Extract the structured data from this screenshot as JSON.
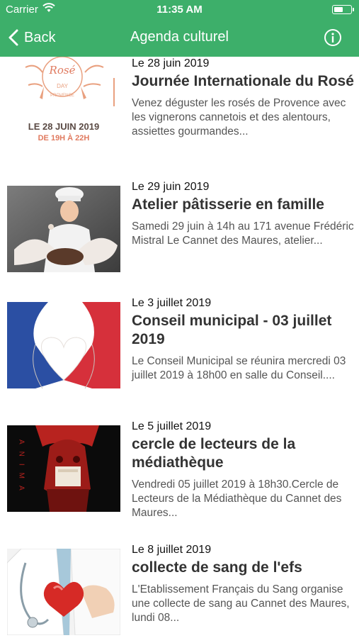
{
  "status": {
    "carrier": "Carrier",
    "time": "11:35 AM"
  },
  "nav": {
    "back_label": "Back",
    "title": "Agenda culturel"
  },
  "colors": {
    "header": "#3daf6a",
    "text": "#333333"
  },
  "events": [
    {
      "date": "Le 28 juin 2019",
      "title": "Journée Internationale du Rosé",
      "description": "Venez déguster les rosés de Provence avec les vignerons cannetois et des alentours, assiettes gourmandes...",
      "poster": {
        "line1": "Rosé",
        "line2": "DAY",
        "line3": "PROVENCE",
        "date_text": "LE 28 JUIN 2019",
        "hours_text": "DE 19H À 22H"
      }
    },
    {
      "date": "Le 29 juin 2019",
      "title": "Atelier pâtisserie en famille",
      "description": "Samedi 29 juin à 14h au 171 avenue Frédéric Mistral Le Cannet des Maures, atelier..."
    },
    {
      "date": "Le 3 juillet 2019",
      "title": "Conseil municipal - 03 juillet 2019",
      "description": "Le Conseil Municipal se réunira mercredi 03 juillet 2019 à 18h00 en salle du Conseil...."
    },
    {
      "date": "Le 5 juillet 2019",
      "title": "cercle de lecteurs de la médiathèque",
      "description": "Vendredi 05 juillet 2019 à 18h30.Cercle de Lecteurs de la Médiathèque du Cannet des Maures...",
      "poster": {
        "vertical_text": "ANIMA"
      }
    },
    {
      "date": "Le 8 juillet 2019",
      "title": "collecte de sang de l'efs",
      "description": "L'Etablissement Français du Sang organise une collecte de sang au Cannet des Maures, lundi 08..."
    }
  ]
}
